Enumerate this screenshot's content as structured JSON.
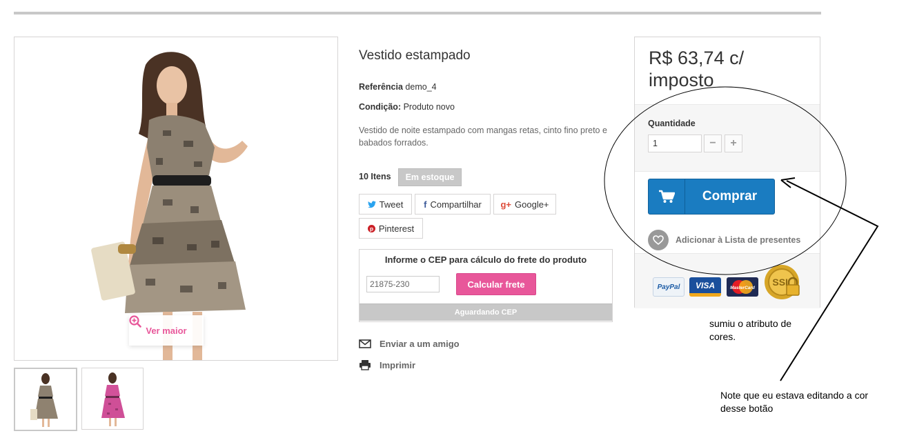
{
  "product": {
    "title": "Vestido estampado",
    "reference_label": "Referência",
    "reference_value": "demo_4",
    "condition_label": "Condição:",
    "condition_value": "Produto novo",
    "description": "Vestido de noite estampado com mangas retas, cinto fino preto e babados forrados.",
    "stock_count": "10 Itens",
    "stock_status": "Em estoque",
    "view_larger": "Ver maior"
  },
  "social": {
    "tweet": "Tweet",
    "share": "Compartilhar",
    "google": "Google+",
    "pinterest": "Pinterest"
  },
  "shipping": {
    "title": "Informe o CEP para cálculo do frete do produto",
    "cep_value": "21875-230",
    "calc_button": "Calcular frete",
    "status": "Aguardando CEP"
  },
  "actions": {
    "send_friend": "Enviar a um amigo",
    "print": "Imprimir"
  },
  "buy_box": {
    "price": "R$ 63,74 c/ imposto",
    "quantity_label": "Quantidade",
    "quantity_value": "1",
    "minus": "−",
    "plus": "+",
    "buy_button": "Comprar",
    "wishlist": "Adicionar à Lista de presentes",
    "payment_logos": [
      "PayPal",
      "VISA",
      "MasterCard",
      "SSL"
    ]
  },
  "annotations": {
    "note_1": "sumiu o atributo de cores.",
    "note_2": "Note que eu estava editando a cor desse botão"
  },
  "colors": {
    "accent_pink": "#e8579a",
    "buy_blue": "#1a7cc1",
    "stock_grey": "#c8c8c8"
  }
}
